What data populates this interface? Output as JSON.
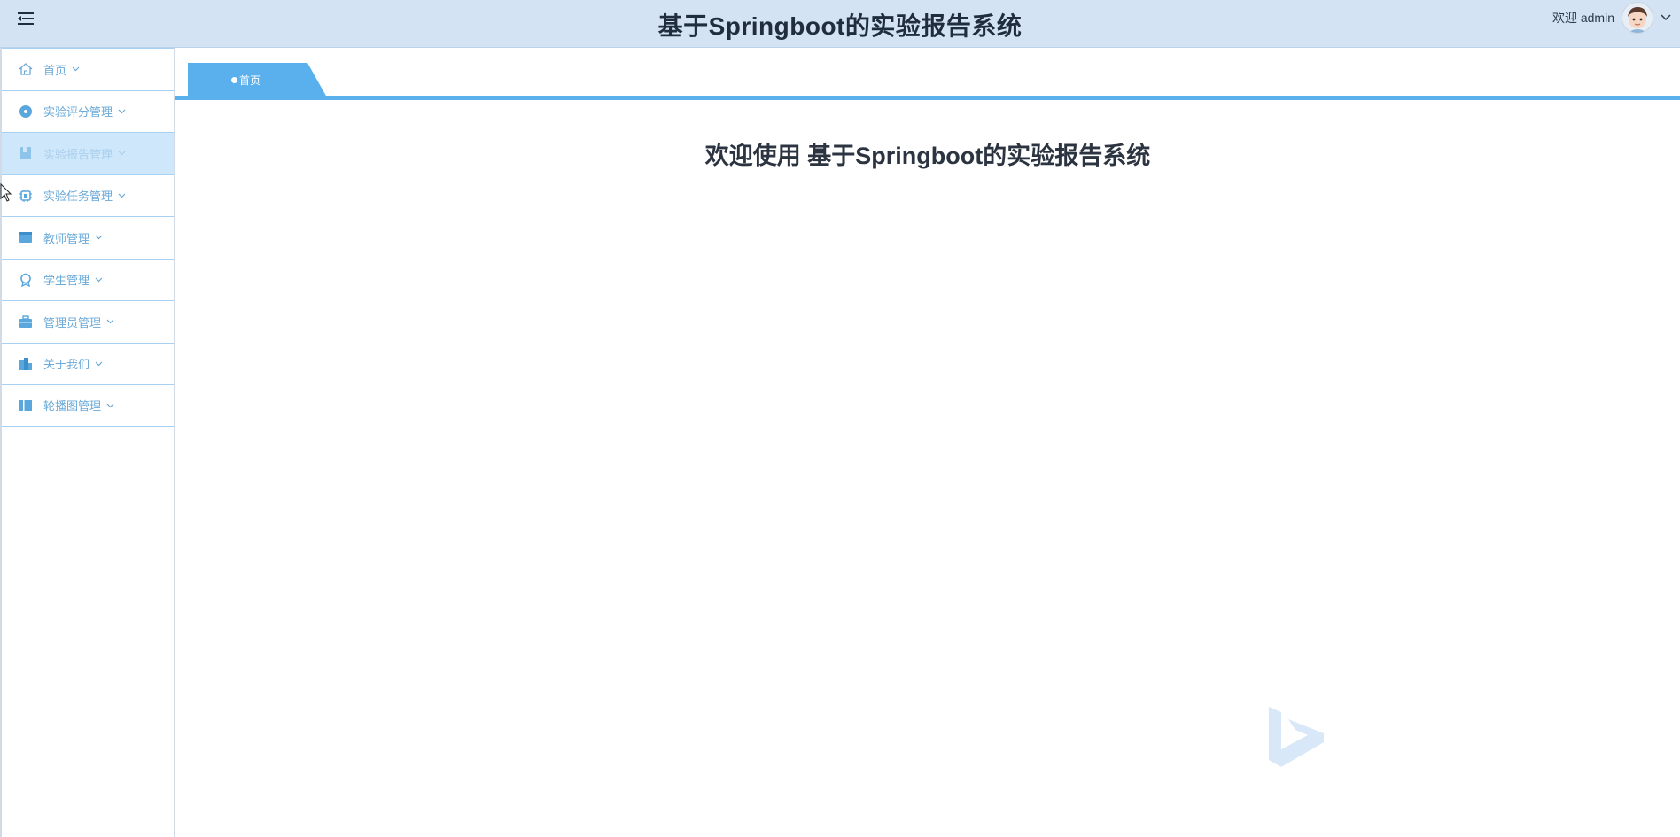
{
  "header": {
    "title": "基于Springboot的实验报告系统",
    "welcome_text": "欢迎 admin"
  },
  "sidebar": {
    "items": [
      {
        "label": "首页",
        "icon": "home-icon"
      },
      {
        "label": "实验评分管理",
        "icon": "disc-icon"
      },
      {
        "label": "实验报告管理",
        "icon": "book-icon",
        "active": true
      },
      {
        "label": "实验任务管理",
        "icon": "chip-icon"
      },
      {
        "label": "教师管理",
        "icon": "card-icon"
      },
      {
        "label": "学生管理",
        "icon": "badge-icon"
      },
      {
        "label": "管理员管理",
        "icon": "briefcase-icon"
      },
      {
        "label": "关于我们",
        "icon": "building-icon"
      },
      {
        "label": "轮播图管理",
        "icon": "panel-icon"
      }
    ]
  },
  "tabs": {
    "home_label": "首页"
  },
  "main": {
    "welcome_heading": "欢迎使用 基于Springboot的实验报告系统"
  },
  "colors": {
    "header_bg": "#d3e3f3",
    "accent": "#59b0ec",
    "nav_text": "#6aa9d8",
    "active_bg": "#cfe7fa"
  }
}
